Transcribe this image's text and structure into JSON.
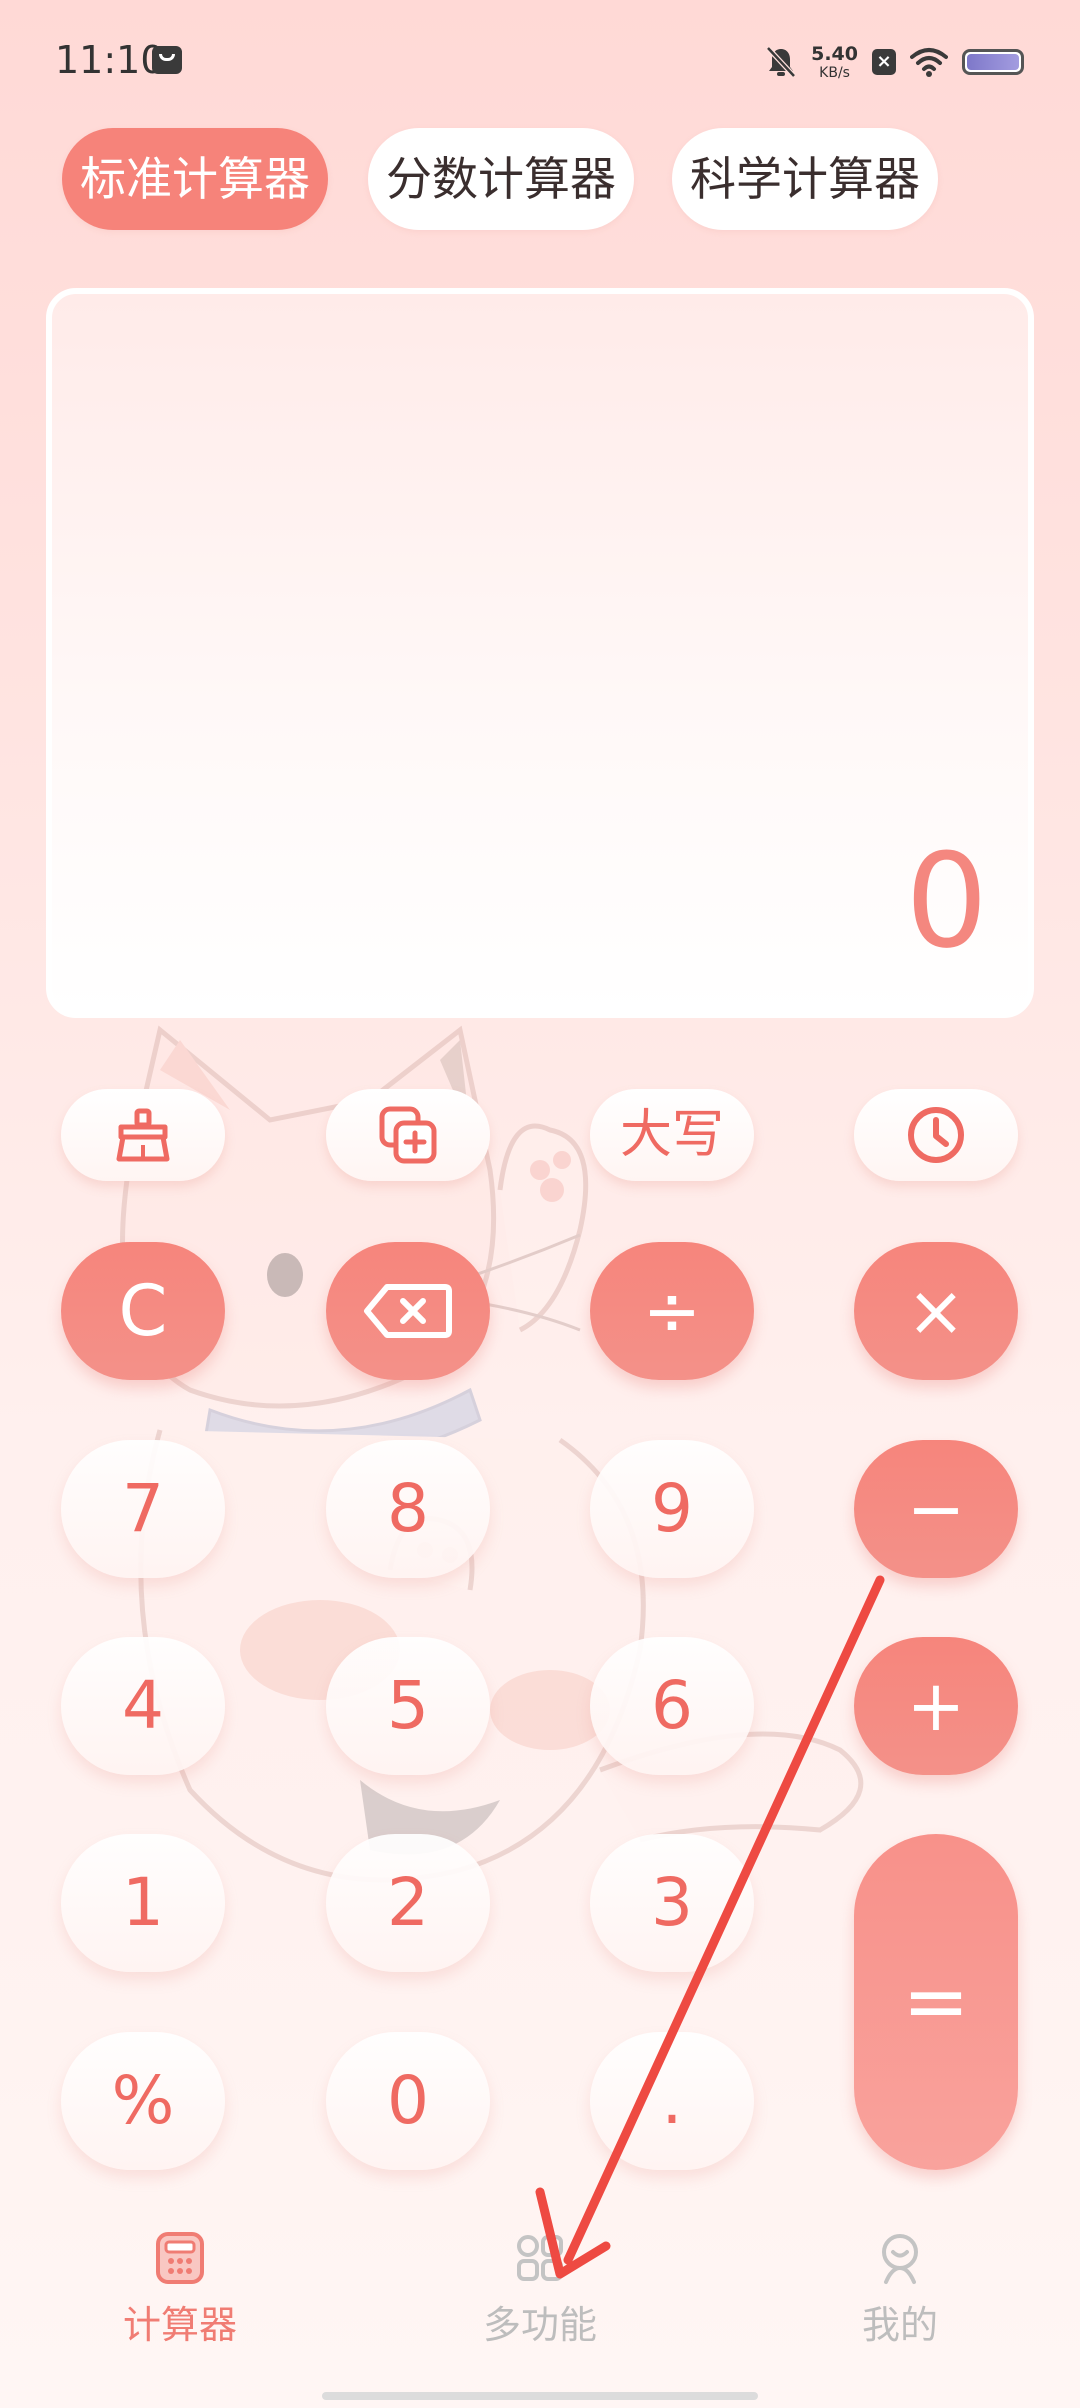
{
  "status_bar": {
    "time": "11:10",
    "net_speed_value": "5.40",
    "net_speed_unit": "KB/s",
    "icons": [
      "message-icon",
      "mute-bell-icon",
      "close-badge-icon",
      "wifi-icon",
      "battery-icon"
    ]
  },
  "mode_tabs": [
    {
      "label": "标准计算器",
      "active": true
    },
    {
      "label": "分数计算器",
      "active": false
    },
    {
      "label": "科学计算器",
      "active": false
    }
  ],
  "display": {
    "value": "0"
  },
  "keypad": {
    "function_row": [
      {
        "icon": "broom-icon"
      },
      {
        "icon": "copy-add-icon"
      },
      {
        "label": "大写"
      },
      {
        "icon": "history-clock-icon"
      }
    ],
    "keys": {
      "clear": "C",
      "backspace_icon": "backspace-icon",
      "divide": "÷",
      "multiply": "×",
      "subtract": "−",
      "add": "+",
      "equals": "=",
      "seven": "7",
      "eight": "8",
      "nine": "9",
      "four": "4",
      "five": "5",
      "six": "6",
      "one": "1",
      "two": "2",
      "three": "3",
      "percent": "%",
      "zero": "0",
      "decimal": "."
    }
  },
  "bottom_nav": [
    {
      "label": "计算器",
      "icon": "calculator-icon",
      "active": true
    },
    {
      "label": "多功能",
      "icon": "grid-icon",
      "active": false
    },
    {
      "label": "我的",
      "icon": "profile-icon",
      "active": false
    }
  ],
  "colors": {
    "accent": "#f6837a",
    "accent_text": "#ef6a62",
    "nav_active": "#f07c73",
    "nav_inactive": "#bdbdbd",
    "overlay_arrow": "#ee4a42"
  }
}
